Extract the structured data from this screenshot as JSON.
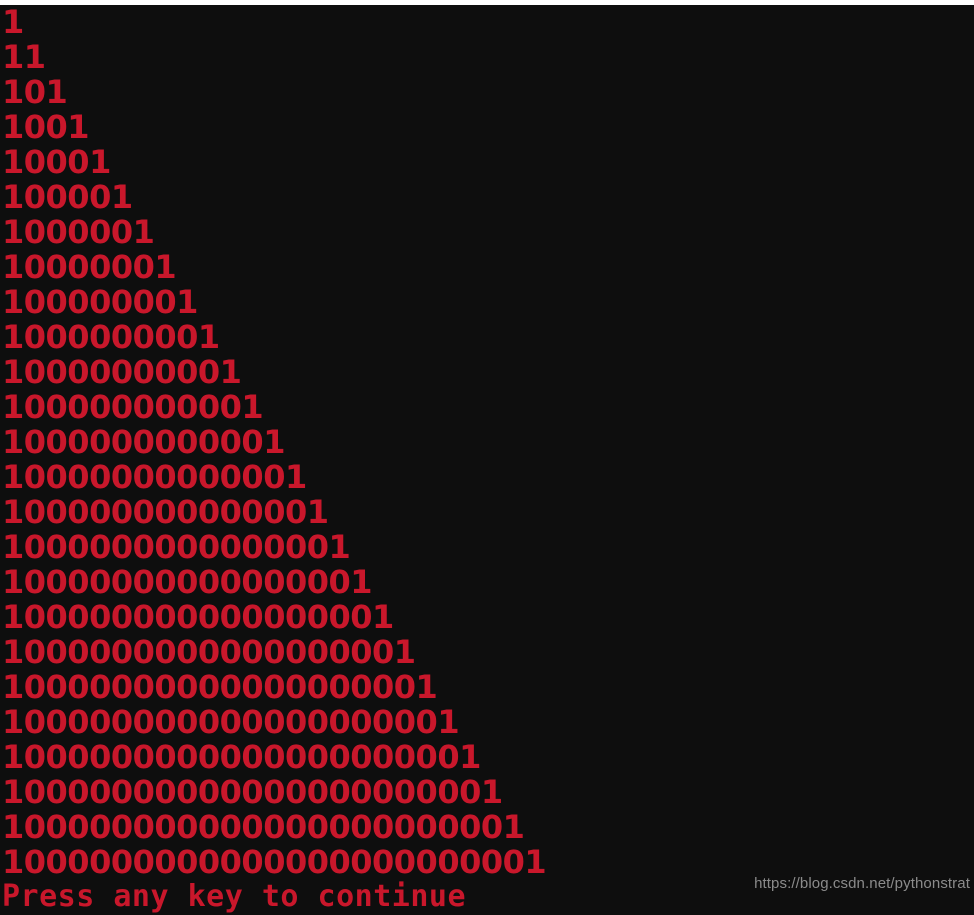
{
  "window": {
    "background_color": "#0e0e0e",
    "text_color": "#c9172b",
    "title_strip_color": "#ffffff"
  },
  "console": {
    "lines": [
      "1",
      "11",
      "101",
      "1001",
      "10001",
      "100001",
      "1000001",
      "10000001",
      "100000001",
      "1000000001",
      "10000000001",
      "100000000001",
      "1000000000001",
      "10000000000001",
      "100000000000001",
      "1000000000000001",
      "10000000000000001",
      "100000000000000001",
      "1000000000000000001",
      "10000000000000000001",
      "100000000000000000001",
      "1000000000000000000001",
      "10000000000000000000001",
      "100000000000000000000001",
      "1000000000000000000000001"
    ],
    "prompt": "Press any key to continue"
  },
  "watermark": {
    "text": "https://blog.csdn.net/pythonstrat",
    "color": "#8b8b8b"
  }
}
